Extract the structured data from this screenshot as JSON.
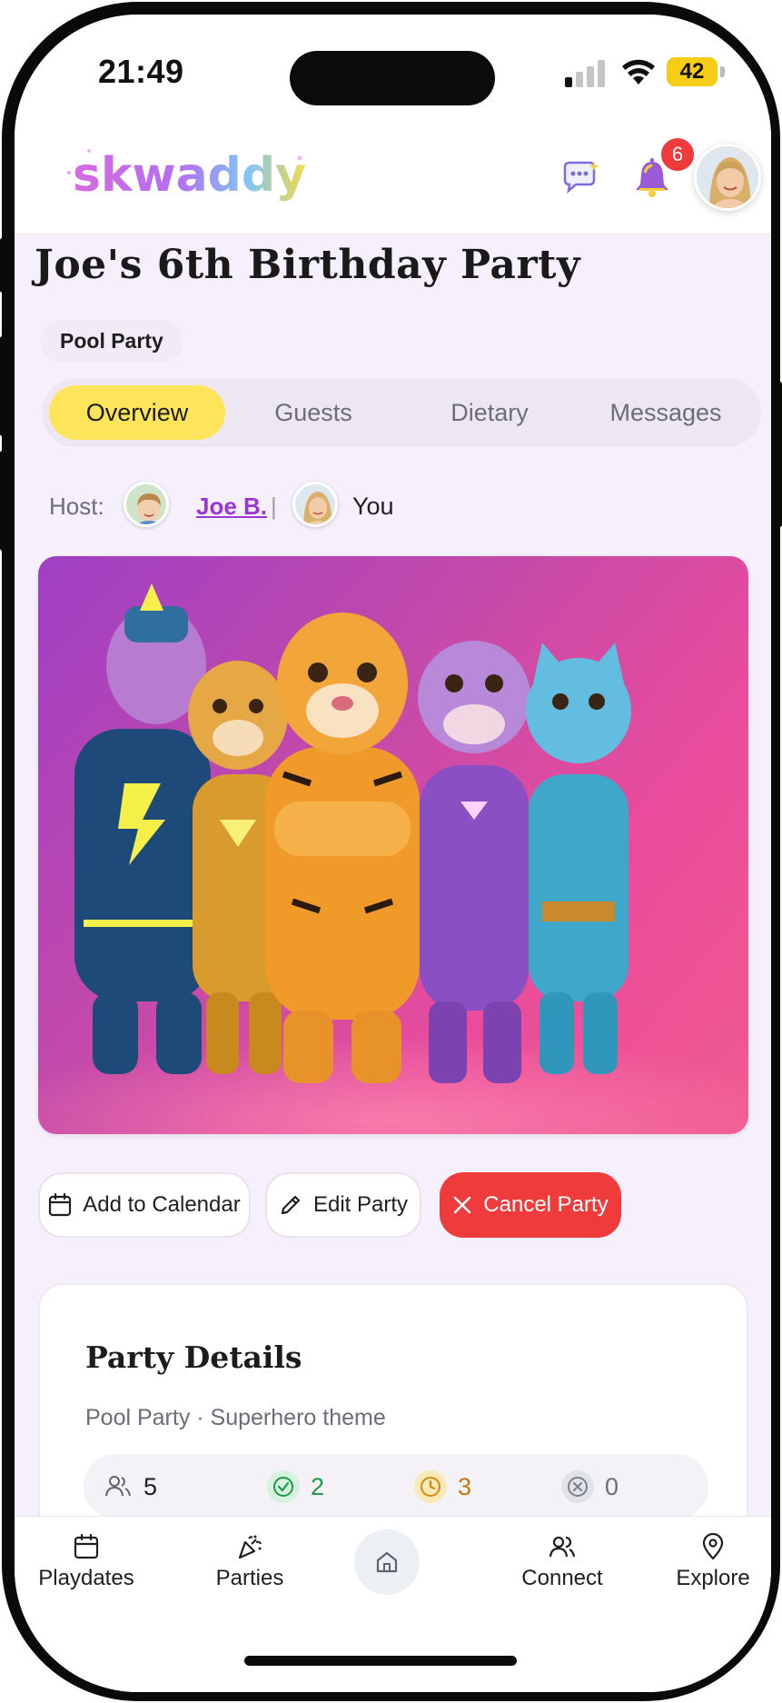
{
  "status": {
    "time": "21:49",
    "battery": "42"
  },
  "header": {
    "logo_text": "skwaddy",
    "notification_count": "6"
  },
  "party": {
    "title": "Joe's 6th Birthday Party",
    "type_badge": "Pool Party"
  },
  "tabs": [
    {
      "label": "Overview",
      "active": true
    },
    {
      "label": "Guests",
      "active": false
    },
    {
      "label": "Dietary",
      "active": false
    },
    {
      "label": "Messages",
      "active": false
    }
  ],
  "host": {
    "label": "Host:",
    "child_name": "Joe B.",
    "separator": "|",
    "parent_name": "You"
  },
  "actions": {
    "add_calendar": "Add to Calendar",
    "edit": "Edit Party",
    "cancel": "Cancel Party"
  },
  "details": {
    "title": "Party Details",
    "subtitle": "Pool Party · Superhero theme",
    "stats": {
      "invited": "5",
      "accepted": "2",
      "pending": "3",
      "declined": "0"
    }
  },
  "bottom_nav": {
    "playdates": "Playdates",
    "parties": "Parties",
    "connect": "Connect",
    "explore": "Explore"
  },
  "colors": {
    "accent_yellow": "#fde45a",
    "danger": "#ef3b3b",
    "link_purple": "#9b36d3",
    "accepted_green": "#1c9a4b",
    "pending_orange": "#d98a0b",
    "declined_gray": "#7b7f8a"
  }
}
